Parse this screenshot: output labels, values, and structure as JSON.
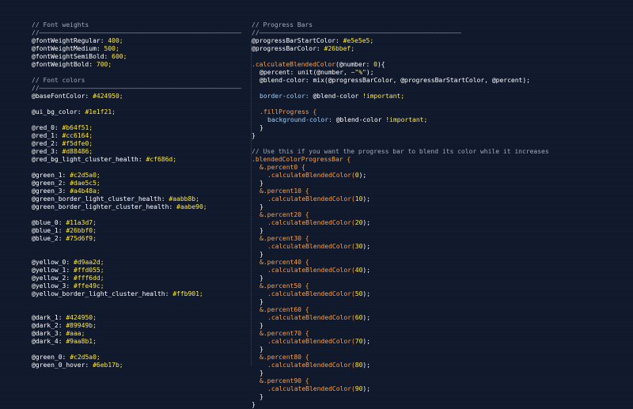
{
  "left_column": [
    {
      "text": "// Font weights",
      "kind": "comment"
    },
    {
      "text": "//—————————————————————————————————————————————————————",
      "kind": "rule"
    },
    {
      "var": "@fontWeightRegular:",
      "val": "400;"
    },
    {
      "var": "@fontWeightMedium:",
      "val": "500;"
    },
    {
      "var": "@fontWeightSemiBold:",
      "val": "600;"
    },
    {
      "var": "@fontWeightBold:",
      "val": "700;"
    },
    {
      "text": "",
      "kind": "blank"
    },
    {
      "text": "// Font colors",
      "kind": "comment"
    },
    {
      "text": "//—————————————————————————————————————————————————————",
      "kind": "rule"
    },
    {
      "var": "@baseFontColor:",
      "val": "#424950;"
    },
    {
      "text": "",
      "kind": "blank"
    },
    {
      "var": "@ui_bg_color:",
      "val": "#1e1f21;"
    },
    {
      "text": "",
      "kind": "blank"
    },
    {
      "var": "@red_0:",
      "val": "#b64f51;"
    },
    {
      "var": "@red_1:",
      "val": "#cc6164;"
    },
    {
      "var": "@red_2:",
      "val": "#f5dfe0;"
    },
    {
      "var": "@red_3:",
      "val": "#d88486;"
    },
    {
      "var": "@red_bg_light_cluster_health:",
      "val": "#cf686d;"
    },
    {
      "text": "",
      "kind": "blank"
    },
    {
      "var": "@green_1:",
      "val": "#c2d5a0;"
    },
    {
      "var": "@green_2:",
      "val": "#dae5c5;"
    },
    {
      "var": "@green_3:",
      "val": "#a4b48a;"
    },
    {
      "var": "@green_border_light_cluster_health:",
      "val": "#aabb8b;"
    },
    {
      "var": "@green_border_lighter_cluster_health:",
      "val": "#aabe90;"
    },
    {
      "text": "",
      "kind": "blank"
    },
    {
      "var": "@blue_0:",
      "val": "#11a3d7;"
    },
    {
      "var": "@blue_1:",
      "val": "#26bbf0;"
    },
    {
      "var": "@blue_2:",
      "val": "#75d6f9;"
    },
    {
      "text": "",
      "kind": "blank"
    },
    {
      "text": "",
      "kind": "blank"
    },
    {
      "var": "@yellow_0:",
      "val": "#d9aa2d;"
    },
    {
      "var": "@yellow_1:",
      "val": "#ffd055;"
    },
    {
      "var": "@yellow_2:",
      "val": "#fff6dd;"
    },
    {
      "var": "@yellow_3:",
      "val": "#ffe49c;"
    },
    {
      "var": "@yellow_border_light_cluster_health:",
      "val": "#ffb901;"
    },
    {
      "text": "",
      "kind": "blank"
    },
    {
      "text": "",
      "kind": "blank"
    },
    {
      "var": "@dark_1:",
      "val": "#424950;"
    },
    {
      "var": "@dark_2:",
      "val": "#89949b;"
    },
    {
      "var": "@dark_3:",
      "val": "#aaa;"
    },
    {
      "var": "@dark_4:",
      "val": "#9aa8b1;"
    },
    {
      "text": "",
      "kind": "blank"
    },
    {
      "var": "@green_0:",
      "val": "#c2d5a0;"
    },
    {
      "var": "@green_0_hover:",
      "val": "#6eb17b;"
    }
  ],
  "right_column": {
    "header_comment": "// Progress Bars",
    "rule": "//—————————————————————————————————————————————————————",
    "start_color": {
      "var": "@progressBarStartColor:",
      "val": "#e5e5e5;"
    },
    "bar_color": {
      "var": "@progressBarColor:",
      "val": "#26bbef;"
    },
    "mixin_decl": {
      "name": ".calculateBlendedColor",
      "open": "(@number: ",
      "num": "0",
      "close": "){"
    },
    "percent_line": {
      "var": "@percent:",
      "fn": " unit(@number, ",
      "str": "~\"%\"",
      "close": ");"
    },
    "blend_line": {
      "var": "@blend-color:",
      "fn": " mix(@progressBarColor, @progressBarStartColor, @percent);"
    },
    "border_line": {
      "prop": "border-color:",
      "fn": " @blend-color ",
      "imp": "!important;"
    },
    "fill_selector": ".fillProgress {",
    "bg_line": {
      "prop": "background-color:",
      "fn": " @blend-color ",
      "imp": "!important;"
    },
    "close_inner": "}",
    "close_outer": "}",
    "use_comment": "// Use this if you want the progress bar to blend its color while it increases",
    "blended_selector": ".blendedColorProgressBar {",
    "percents": [
      {
        "sel": "&.percent0 {",
        "call": ".calculateBlendedColor(",
        "num": "0",
        "end": ");"
      },
      {
        "sel": "&.percent10 {",
        "call": ".calculateBlendedColor(",
        "num": "10",
        "end": ");"
      },
      {
        "sel": "&.percent20 {",
        "call": ".calculateBlendedColor(",
        "num": "20",
        "end": ");"
      },
      {
        "sel": "&.percent30 {",
        "call": ".calculateBlendedColor(",
        "num": "30",
        "end": ");"
      },
      {
        "sel": "&.percent40 {",
        "call": ".calculateBlendedColor(",
        "num": "40",
        "end": ");"
      },
      {
        "sel": "&.percent50 {",
        "call": ".calculateBlendedColor(",
        "num": "50",
        "end": ");"
      },
      {
        "sel": "&.percent60 {",
        "call": ".calculateBlendedColor(",
        "num": "60",
        "end": ");"
      },
      {
        "sel": "&.percent70 {",
        "call": ".calculateBlendedColor(",
        "num": "70",
        "end": ");"
      },
      {
        "sel": "&.percent80 {",
        "call": ".calculateBlendedColor(",
        "num": "80",
        "end": ");"
      },
      {
        "sel": "&.percent90 {",
        "call": ".calculateBlendedColor(",
        "num": "90",
        "end": ");"
      }
    ],
    "brace": "}"
  },
  "colors": {
    "background": "#10182c",
    "comment": "#a2a9b8",
    "value": "#ffe940",
    "selector": "#ff9f40",
    "property": "#9ecfff"
  }
}
